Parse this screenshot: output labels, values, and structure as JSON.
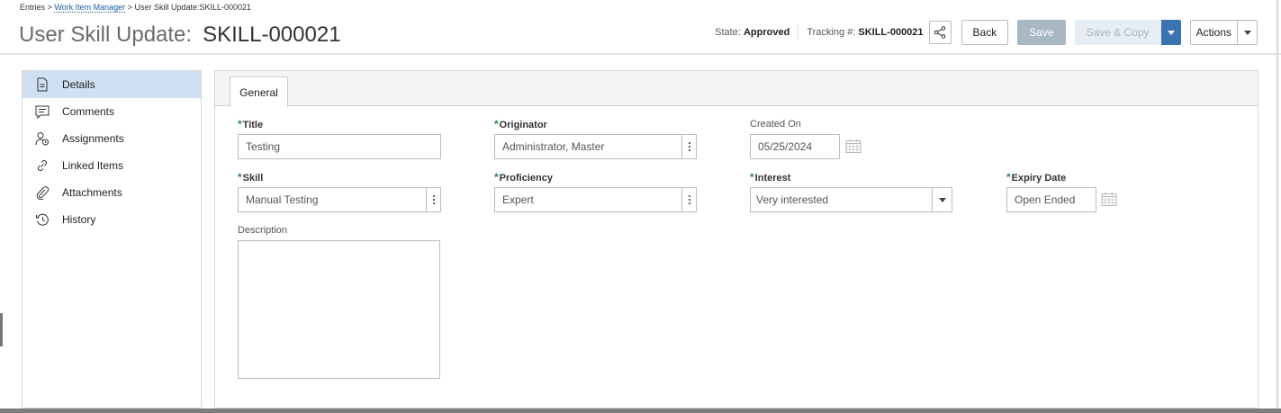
{
  "breadcrumb": {
    "root": "Entries",
    "sep1": ">",
    "link": "Work Item Manager",
    "sep2": ">",
    "current": "User Skill Update:SKILL-000021"
  },
  "title": {
    "prefix": "User Skill Update:",
    "id": "SKILL-000021"
  },
  "header": {
    "state_label": "State:",
    "state_value": "Approved",
    "tracking_label": "Tracking #:",
    "tracking_value": "SKILL-000021",
    "share_icon": "share-icon",
    "back_label": "Back",
    "save_label": "Save",
    "save_copy_label": "Save & Copy",
    "actions_label": "Actions"
  },
  "sidebar": {
    "items": [
      {
        "label": "Details",
        "icon": "document-icon",
        "active": true
      },
      {
        "label": "Comments",
        "icon": "comment-icon",
        "active": false
      },
      {
        "label": "Assignments",
        "icon": "assignment-icon",
        "active": false
      },
      {
        "label": "Linked Items",
        "icon": "link-icon",
        "active": false
      },
      {
        "label": "Attachments",
        "icon": "paperclip-icon",
        "active": false
      },
      {
        "label": "History",
        "icon": "history-icon",
        "active": false
      }
    ]
  },
  "tabs": {
    "general": "General"
  },
  "form": {
    "title": {
      "label": "Title",
      "value": "Testing"
    },
    "originator": {
      "label": "Originator",
      "value": "Administrator, Master"
    },
    "created_on": {
      "label": "Created On",
      "value": "05/25/2024"
    },
    "skill": {
      "label": "Skill",
      "value": "Manual Testing"
    },
    "proficiency": {
      "label": "Proficiency",
      "value": "Expert"
    },
    "interest": {
      "label": "Interest",
      "value": "Very interested"
    },
    "expiry_date": {
      "label": "Expiry Date",
      "value": "Open Ended"
    },
    "description": {
      "label": "Description",
      "value": ""
    }
  },
  "colors": {
    "accent": "#3b73b0",
    "active_sidebar": "#cfe0f2",
    "required_star": "#2e8b3a",
    "save_disabled": "#a8b9c4"
  }
}
